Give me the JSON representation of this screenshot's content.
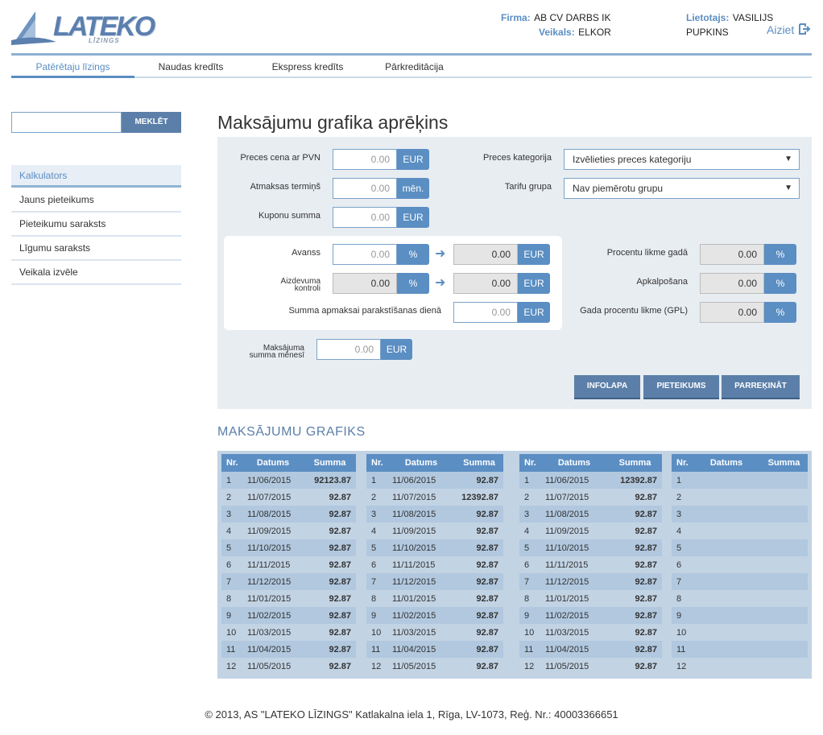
{
  "brand": {
    "logo_word": "LATEKO",
    "logo_sub": "LĪZINGS"
  },
  "header": {
    "firma_label": "Firma:",
    "firma_value": "AB CV DARBS IK",
    "veikals_label": "Veikals:",
    "veikals_value": "ELKOR",
    "user_label": "Lietotajs:",
    "user_value": "VASILIJS PUPKINS",
    "logout": "Aiziet"
  },
  "nav": {
    "tabs": [
      "Patērētaju līzings",
      "Naudas kredīts",
      "Ekspress kredīts",
      "Pārkreditācija"
    ],
    "active": 0
  },
  "search": {
    "placeholder": "",
    "button": "MEKLĒT"
  },
  "sidebar": {
    "head": "Kalkulators",
    "items": [
      "Jauns pieteikums",
      "Pieteikumu saraksts",
      "Līgumu saraksts",
      "Veikala izvēle"
    ]
  },
  "page_title": "Maksājumu grafika aprēķins",
  "form": {
    "price_label": "Preces cena ar PVN",
    "price_value": "0.00",
    "price_unit": "EUR",
    "term_label": "Atmaksas termiņš",
    "term_value": "0.00",
    "term_unit": "mēn.",
    "coupon_label": "Kuponu summa",
    "coupon_value": "0.00",
    "coupon_unit": "EUR",
    "category_label": "Preces kategorija",
    "category_value": "Izvēlieties preces kategoriju",
    "tariff_label": "Tarifu grupa",
    "tariff_value": "Nav piemērotu grupu",
    "avans_label": "Avanss",
    "avans_pct": "0.00",
    "avans_eur": "0.00",
    "aizdevums_label1": "Aizdevuma",
    "aizdevums_label2": "kontroli",
    "aizdevums_pct": "0.00",
    "aizdevums_eur": "0.00",
    "sign_label": "Summa apmaksai parakstīšanas dienā",
    "sign_value": "0.00",
    "rate_label": "Procentu likme gadā",
    "rate_value": "0.00",
    "service_label": "Apkalpošana",
    "service_value": "0.00",
    "gpl_label": "Gada procentu likme (GPL)",
    "gpl_value": "0.00",
    "monthly_label1": "Maksājuma",
    "monthly_label2": "summa mēnesī",
    "monthly_value": "0.00",
    "pct_unit": "%",
    "eur_unit": "EUR"
  },
  "buttons": {
    "infolapa": "INFOLAPA",
    "pieteikums": "PIETEIKUMS",
    "parrekinat": "PARREĶINĀT"
  },
  "schedule": {
    "title": "MAKSĀJUMU GRAFIKS",
    "headers": [
      "Nr.",
      "Datums",
      "Summa"
    ],
    "tables": [
      {
        "rows": [
          [
            "1",
            "11/06/2015",
            "92123.87"
          ],
          [
            "2",
            "11/07/2015",
            "92.87"
          ],
          [
            "3",
            "11/08/2015",
            "92.87"
          ],
          [
            "4",
            "11/09/2015",
            "92.87"
          ],
          [
            "5",
            "11/10/2015",
            "92.87"
          ],
          [
            "6",
            "11/11/2015",
            "92.87"
          ],
          [
            "7",
            "11/12/2015",
            "92.87"
          ],
          [
            "8",
            "11/01/2015",
            "92.87"
          ],
          [
            "9",
            "11/02/2015",
            "92.87"
          ],
          [
            "10",
            "11/03/2015",
            "92.87"
          ],
          [
            "11",
            "11/04/2015",
            "92.87"
          ],
          [
            "12",
            "11/05/2015",
            "92.87"
          ]
        ]
      },
      {
        "rows": [
          [
            "1",
            "11/06/2015",
            "92.87"
          ],
          [
            "2",
            "11/07/2015",
            "12392.87"
          ],
          [
            "3",
            "11/08/2015",
            "92.87"
          ],
          [
            "4",
            "11/09/2015",
            "92.87"
          ],
          [
            "5",
            "11/10/2015",
            "92.87"
          ],
          [
            "6",
            "11/11/2015",
            "92.87"
          ],
          [
            "7",
            "11/12/2015",
            "92.87"
          ],
          [
            "8",
            "11/01/2015",
            "92.87"
          ],
          [
            "9",
            "11/02/2015",
            "92.87"
          ],
          [
            "10",
            "11/03/2015",
            "92.87"
          ],
          [
            "11",
            "11/04/2015",
            "92.87"
          ],
          [
            "12",
            "11/05/2015",
            "92.87"
          ]
        ]
      },
      {
        "rows": [
          [
            "1",
            "11/06/2015",
            "12392.87"
          ],
          [
            "2",
            "11/07/2015",
            "92.87"
          ],
          [
            "3",
            "11/08/2015",
            "92.87"
          ],
          [
            "4",
            "11/09/2015",
            "92.87"
          ],
          [
            "5",
            "11/10/2015",
            "92.87"
          ],
          [
            "6",
            "11/11/2015",
            "92.87"
          ],
          [
            "7",
            "11/12/2015",
            "92.87"
          ],
          [
            "8",
            "11/01/2015",
            "92.87"
          ],
          [
            "9",
            "11/02/2015",
            "92.87"
          ],
          [
            "10",
            "11/03/2015",
            "92.87"
          ],
          [
            "11",
            "11/04/2015",
            "92.87"
          ],
          [
            "12",
            "11/05/2015",
            "92.87"
          ]
        ]
      },
      {
        "rows": [
          [
            "1",
            "",
            ""
          ],
          [
            "2",
            "",
            ""
          ],
          [
            "3",
            "",
            ""
          ],
          [
            "4",
            "",
            ""
          ],
          [
            "5",
            "",
            ""
          ],
          [
            "6",
            "",
            ""
          ],
          [
            "7",
            "",
            ""
          ],
          [
            "8",
            "",
            ""
          ],
          [
            "9",
            "",
            ""
          ],
          [
            "10",
            "",
            ""
          ],
          [
            "11",
            "",
            ""
          ],
          [
            "12",
            "",
            ""
          ]
        ]
      }
    ]
  },
  "footer": "© 2013, AS \"LATEKO LĪZINGS\" Katlakalna iela 1, Rīga, LV-1073, Reģ. Nr.: 40003366651"
}
